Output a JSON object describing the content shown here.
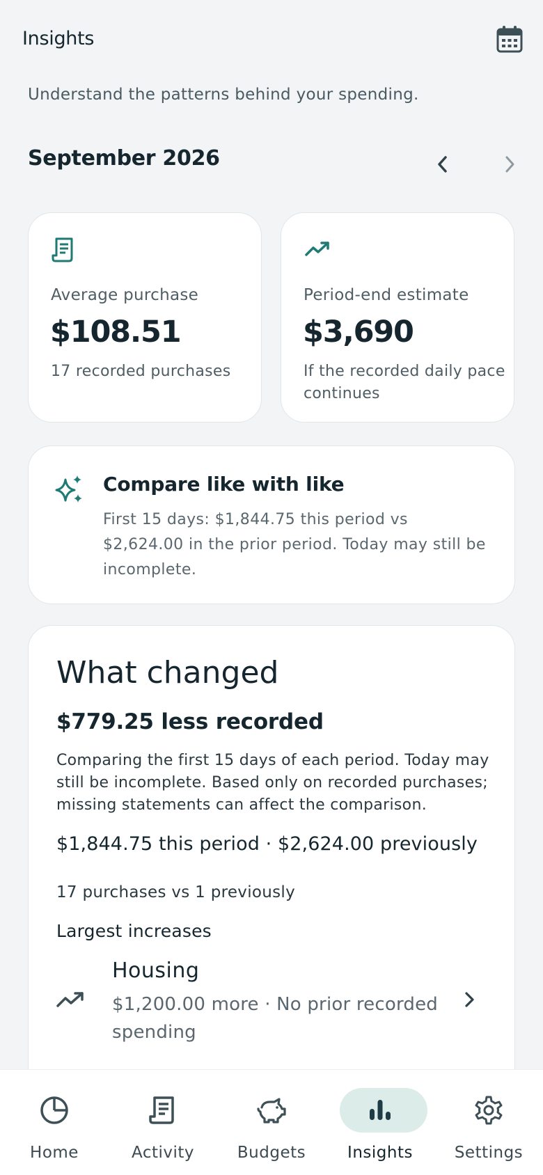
{
  "header": {
    "title": "Insights",
    "calendar_icon": "calendar-icon",
    "subtitle": "Understand the patterns behind your spending."
  },
  "period": {
    "label": "September 2026",
    "prev_icon": "chevron-left-icon",
    "next_icon": "chevron-right-icon"
  },
  "stats": [
    {
      "icon": "receipt-icon",
      "label": "Average purchase",
      "value": "$108.51",
      "note": "17 recorded purchases"
    },
    {
      "icon": "trending-up-icon",
      "label": "Period-end estimate",
      "value": "$3,690",
      "note": "If the recorded daily pace continues"
    }
  ],
  "compare": {
    "icon": "sparkles-icon",
    "title": "Compare like with like",
    "body": "First 15 days: $1,844.75 this period vs $2,624.00 in the prior period. Today may still be incomplete."
  },
  "changed": {
    "heading": "What changed",
    "summary": "$779.25 less recorded",
    "description": "Comparing the first 15 days of each period. Today may still be incomplete. Based only on recorded purchases; missing statements can affect the comparison.",
    "totals": "$1,844.75 this period · $2,624.00 previously",
    "counts": "17 purchases vs 1 previously",
    "increases_label": "Largest increases",
    "increases": [
      {
        "icon": "trending-up-icon",
        "name": "Housing",
        "detail": "$1,200.00 more · No prior recorded spending"
      }
    ]
  },
  "nav": {
    "items": [
      {
        "label": "Home",
        "icon": "pie-chart-icon",
        "active": false
      },
      {
        "label": "Activity",
        "icon": "receipt-icon",
        "active": false
      },
      {
        "label": "Budgets",
        "icon": "piggy-bank-icon",
        "active": false
      },
      {
        "label": "Insights",
        "icon": "bar-chart-icon",
        "active": true
      },
      {
        "label": "Settings",
        "icon": "gear-icon",
        "active": false
      }
    ]
  },
  "colors": {
    "accent": "#1e7a72",
    "background": "#f2f4f6",
    "card": "#ffffff",
    "text_primary": "#15262e",
    "text_secondary": "#4f5d64",
    "nav_active_pill": "#dbece9"
  }
}
